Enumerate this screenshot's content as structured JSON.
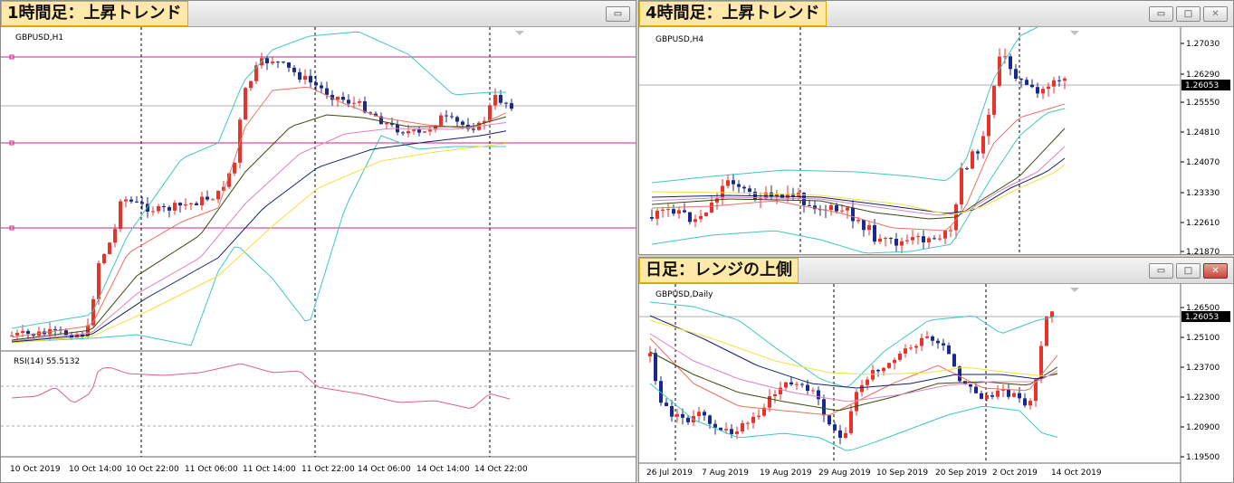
{
  "windows": {
    "h1": {
      "title": "1時間足：上昇トレンド",
      "symbol": "GBPUSD,H1",
      "rsi_label": "RSI(14) 55.5132",
      "time_labels": [
        "10 Oct 2019",
        "10 Oct 14:00",
        "10 Oct 22:00",
        "11 Oct 06:00",
        "11 Oct 14:00",
        "11 Oct 22:00",
        "14 Oct 06:00",
        "14 Oct 14:00",
        "14 Oct 22:00"
      ]
    },
    "h4": {
      "title": "4時間足：上昇トレンド",
      "symbol": "GBPUSD,H4",
      "price_labels": [
        "1.27030",
        "1.26290",
        "1.25550",
        "1.24810",
        "1.24070",
        "1.23330",
        "1.22610",
        "1.21870"
      ],
      "current_price": "1.26053"
    },
    "d1": {
      "title": "日足：レンジの上側",
      "symbol": "GBPUSD,Daily",
      "price_labels": [
        "1.26500",
        "1.25100",
        "1.23700",
        "1.22300",
        "1.20900",
        "1.19500"
      ],
      "current_price": "1.26053",
      "time_labels": [
        "26 Jul 2019",
        "7 Aug 2019",
        "19 Aug 2019",
        "29 Aug 2019",
        "10 Sep 2019",
        "20 Sep 2019",
        "2 Oct 2019",
        "14 Oct 2019"
      ]
    }
  },
  "window_buttons": {
    "minimize": "▭",
    "maximize": "□",
    "close": "✕"
  },
  "colors": {
    "bull": "#e8322c",
    "bear": "#1a2a8a",
    "bb": "#40c8c0",
    "ema_red": "#f07060",
    "ema_olive": "#3a4a10",
    "ema_pink": "#e080c0",
    "ema_navy": "#102070",
    "ema_yellow": "#f0e040",
    "hline_magenta": "#cc2288",
    "rsi": "#e06080",
    "current_line": "#b0b0b0"
  }
}
